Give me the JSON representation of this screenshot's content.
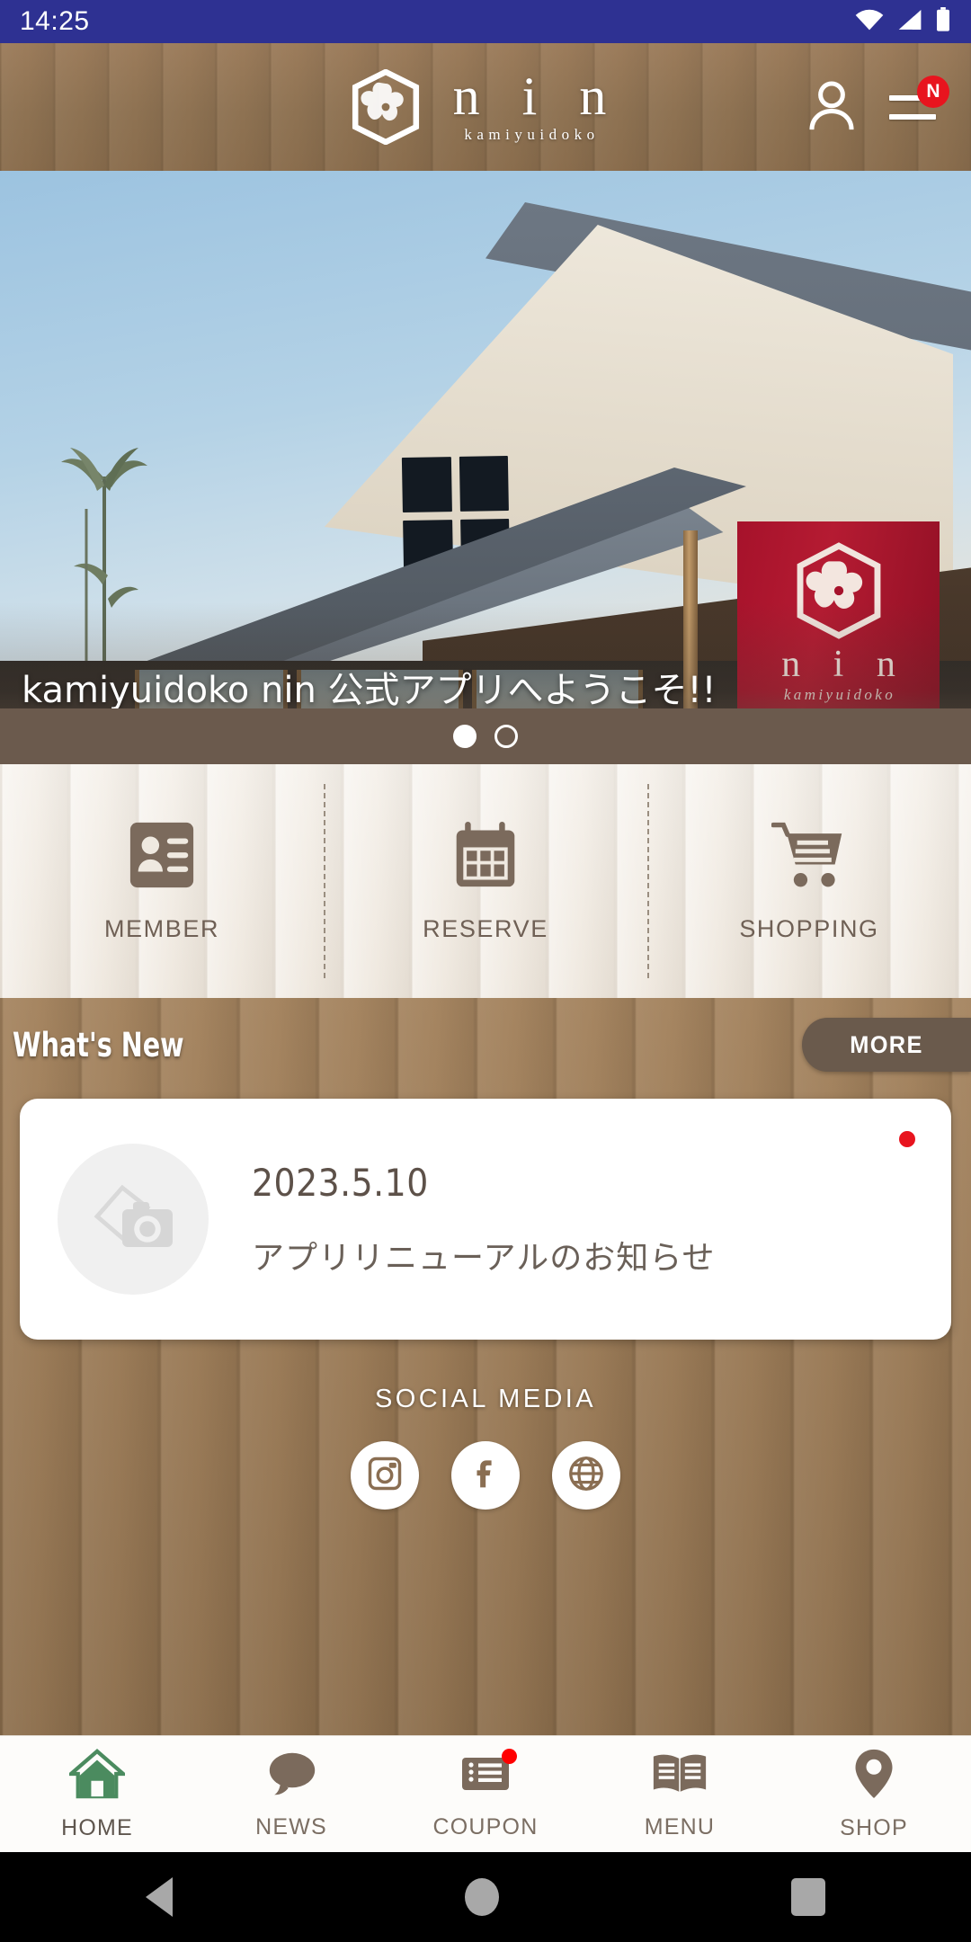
{
  "status_bar": {
    "time": "14:25",
    "icons": [
      "wifi-icon",
      "cellular-signal-icon",
      "battery-icon"
    ],
    "background_color": "#2e3192"
  },
  "header": {
    "logo_crest": "nin-hexagon-flower-crest-icon",
    "brand": "n i n",
    "brand_sub": "kamiyuidoko",
    "account_icon": "person-icon",
    "menu_icon": "hamburger-menu-icon",
    "menu_badge": "N",
    "badge_color": "#e8141e"
  },
  "hero": {
    "caption": "kamiyuidoko nin 公式アプリへようこそ!!",
    "banner_brand": "n i n",
    "banner_sub": "kamiyuidoko",
    "slides_total": 2,
    "active_slide": 1,
    "alt": "traditional Japanese tiled-roof salon building with red noren banner"
  },
  "quick_actions": [
    {
      "label": "MEMBER",
      "icon": "member-card-icon"
    },
    {
      "label": "RESERVE",
      "icon": "calendar-icon"
    },
    {
      "label": "SHOPPING",
      "icon": "shopping-cart-icon"
    }
  ],
  "whats_new": {
    "heading": "What's New",
    "more_label": "MORE",
    "items": [
      {
        "date": "2023.5.10",
        "subject": "アプリリニューアルのお知らせ",
        "thumb_icon": "photo-camera-placeholder-icon",
        "unread": true
      }
    ]
  },
  "social": {
    "title": "SOCIAL MEDIA",
    "links": [
      {
        "name": "instagram",
        "icon": "instagram-icon"
      },
      {
        "name": "facebook",
        "icon": "facebook-icon"
      },
      {
        "name": "website",
        "icon": "globe-icon"
      }
    ]
  },
  "tabbar": {
    "active": "HOME",
    "accent_color": "#4b8b5f",
    "items": [
      {
        "label": "HOME",
        "icon": "home-icon",
        "active": true,
        "badge": false
      },
      {
        "label": "NEWS",
        "icon": "speech-bubble-icon",
        "active": false,
        "badge": false
      },
      {
        "label": "COUPON",
        "icon": "ticket-icon",
        "active": false,
        "badge": true
      },
      {
        "label": "MENU",
        "icon": "open-book-icon",
        "active": false,
        "badge": false
      },
      {
        "label": "SHOP",
        "icon": "map-pin-icon",
        "active": false,
        "badge": false
      }
    ]
  },
  "android_nav": {
    "back": "back-triangle-icon",
    "home": "home-circle-icon",
    "recents": "recents-square-icon"
  }
}
